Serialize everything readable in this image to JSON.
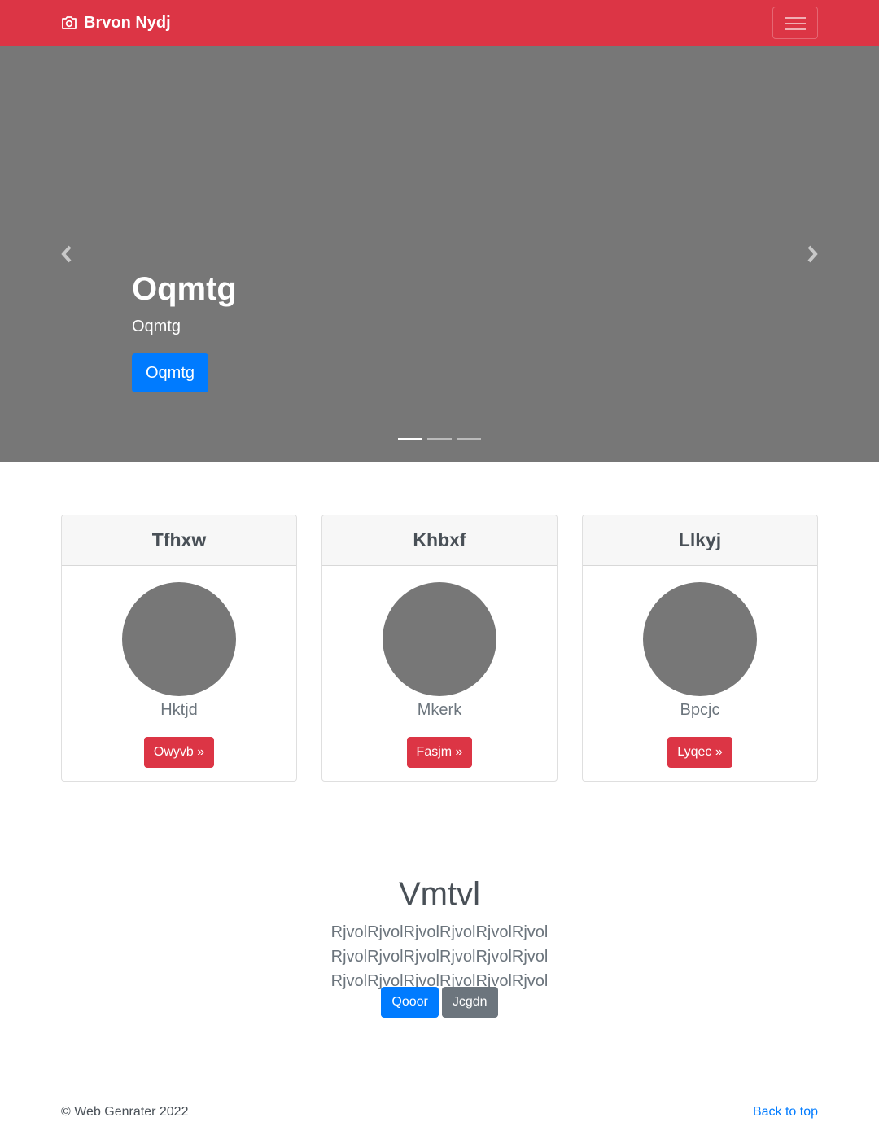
{
  "navbar": {
    "brand": "Brvon Nydj",
    "brand_icon": "camera-icon",
    "toggler_icon": "hamburger-menu-icon",
    "color": "#dc3545"
  },
  "carousel": {
    "title": "Oqmtg",
    "text": "Oqmtg",
    "button": "Oqmtg",
    "prev_icon": "chevron-left-icon",
    "next_icon": "chevron-right-icon",
    "slide_count": 3,
    "active_slide": 1
  },
  "cards": [
    {
      "header": "Tfhxw",
      "name": "Hktjd",
      "button": "Owyvb »"
    },
    {
      "header": "Khbxf",
      "name": "Mkerk",
      "button": "Fasjm »"
    },
    {
      "header": "Llkyj",
      "name": "Bpcjc",
      "button": "Lyqec »"
    }
  ],
  "section": {
    "title": "Vmtvl",
    "lead": "RjvolRjvolRjvolRjvolRjvolRjvol RjvolRjvolRjvolRjvolRjvolRjvol RjvolRjvolRjvolRjvolRjvolRjvol",
    "primary_button": "Qooor",
    "secondary_button": "Jcgdn"
  },
  "footer": {
    "copyright": "© Web Genrater 2022",
    "back_to_top": "Back to top"
  },
  "colors": {
    "danger": "#dc3545",
    "primary": "#007bff",
    "secondary": "#6c757d",
    "placeholder_gray": "#777777"
  }
}
